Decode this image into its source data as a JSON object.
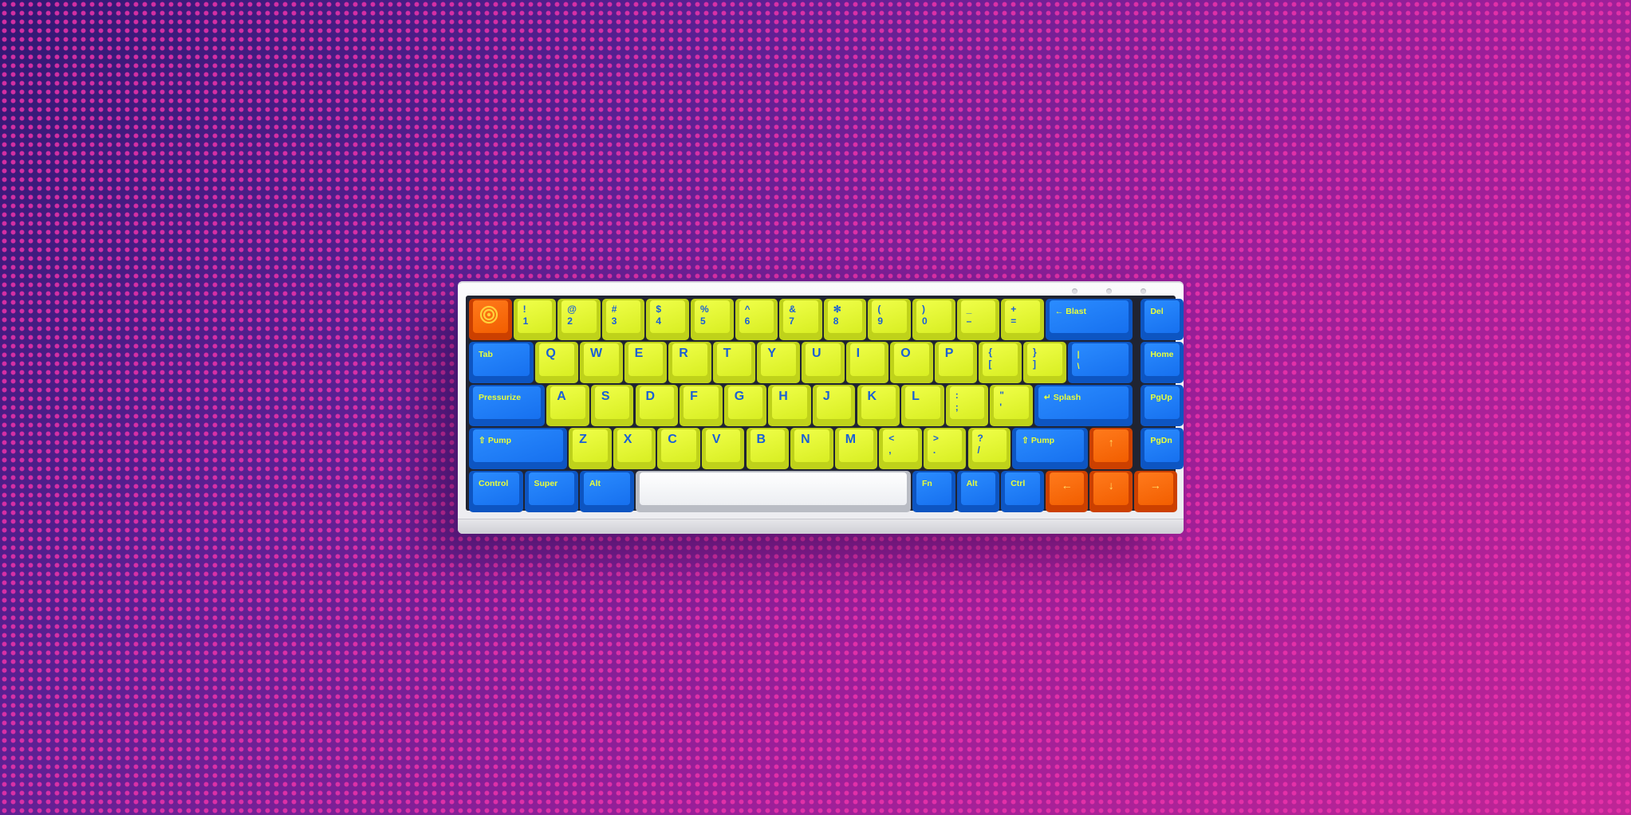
{
  "colors": {
    "alpha_keys": "#e6f72a",
    "modifier_keys": "#1a73f0",
    "accent_keys": "#f56300",
    "space_bar": "#f4f5f7",
    "case": "#f2f2f5",
    "background_start": "#321873",
    "background_end": "#bf2596"
  },
  "keyboard": {
    "rows": [
      [
        {
          "id": "esc",
          "color": "o",
          "icon": "target-icon",
          "w": 1
        },
        {
          "id": "1",
          "label": "!\n1",
          "color": "y",
          "w": 1
        },
        {
          "id": "2",
          "label": "@\n2",
          "color": "y",
          "w": 1
        },
        {
          "id": "3",
          "label": "#\n3",
          "color": "y",
          "w": 1
        },
        {
          "id": "4",
          "label": "$\n4",
          "color": "y",
          "w": 1
        },
        {
          "id": "5",
          "label": "%\n5",
          "color": "y",
          "w": 1
        },
        {
          "id": "6",
          "label": "^\n6",
          "color": "y",
          "w": 1
        },
        {
          "id": "7",
          "label": "&\n7",
          "color": "y",
          "w": 1
        },
        {
          "id": "8",
          "label": "✻\n8",
          "color": "y",
          "w": 1
        },
        {
          "id": "9",
          "label": "(\n9",
          "color": "y",
          "w": 1
        },
        {
          "id": "0",
          "label": ")\n0",
          "color": "y",
          "w": 1
        },
        {
          "id": "minus",
          "label": "_\n–",
          "color": "y",
          "w": 1
        },
        {
          "id": "equal",
          "label": "+\n=",
          "color": "y",
          "w": 1
        },
        {
          "id": "backspace",
          "label": "Blast",
          "icon": "arrow-left-icon",
          "color": "b",
          "w": 2
        },
        {
          "id": "gap",
          "gap": 0.15
        },
        {
          "id": "del",
          "label": "Del",
          "color": "b",
          "w": 1
        }
      ],
      [
        {
          "id": "tab",
          "label": "Tab",
          "color": "b",
          "w": 1.5
        },
        {
          "id": "q",
          "label": "Q",
          "color": "y",
          "w": 1,
          "big": true
        },
        {
          "id": "w",
          "label": "W",
          "color": "y",
          "w": 1,
          "big": true
        },
        {
          "id": "e",
          "label": "E",
          "color": "y",
          "w": 1,
          "big": true
        },
        {
          "id": "r",
          "label": "R",
          "color": "y",
          "w": 1,
          "big": true
        },
        {
          "id": "t",
          "label": "T",
          "color": "y",
          "w": 1,
          "big": true
        },
        {
          "id": "y",
          "label": "Y",
          "color": "y",
          "w": 1,
          "big": true
        },
        {
          "id": "u",
          "label": "U",
          "color": "y",
          "w": 1,
          "big": true
        },
        {
          "id": "i",
          "label": "I",
          "color": "y",
          "w": 1,
          "big": true
        },
        {
          "id": "o",
          "label": "O",
          "color": "y",
          "w": 1,
          "big": true
        },
        {
          "id": "p",
          "label": "P",
          "color": "y",
          "w": 1,
          "big": true
        },
        {
          "id": "lbracket",
          "label": "{\n[",
          "color": "y",
          "w": 1
        },
        {
          "id": "rbracket",
          "label": "}\n]",
          "color": "y",
          "w": 1
        },
        {
          "id": "backslash",
          "label": "|\n\\",
          "color": "b",
          "w": 1.5
        },
        {
          "id": "gap",
          "gap": 0.15
        },
        {
          "id": "home",
          "label": "Home",
          "color": "b",
          "w": 1
        }
      ],
      [
        {
          "id": "caps",
          "label": "Pressurize",
          "color": "b",
          "w": 1.75
        },
        {
          "id": "a",
          "label": "A",
          "color": "y",
          "w": 1,
          "big": true
        },
        {
          "id": "s",
          "label": "S",
          "color": "y",
          "w": 1,
          "big": true
        },
        {
          "id": "d",
          "label": "D",
          "color": "y",
          "w": 1,
          "big": true
        },
        {
          "id": "f",
          "label": "F",
          "color": "y",
          "w": 1,
          "big": true
        },
        {
          "id": "g",
          "label": "G",
          "color": "y",
          "w": 1,
          "big": true
        },
        {
          "id": "h",
          "label": "H",
          "color": "y",
          "w": 1,
          "big": true
        },
        {
          "id": "j",
          "label": "J",
          "color": "y",
          "w": 1,
          "big": true
        },
        {
          "id": "k",
          "label": "K",
          "color": "y",
          "w": 1,
          "big": true
        },
        {
          "id": "l",
          "label": "L",
          "color": "y",
          "w": 1,
          "big": true
        },
        {
          "id": "semicolon",
          "label": ":\n;",
          "color": "y",
          "w": 1
        },
        {
          "id": "quote",
          "label": "\"\n'",
          "color": "y",
          "w": 1
        },
        {
          "id": "enter",
          "label": "Splash",
          "icon": "return-icon",
          "color": "b",
          "w": 2.25
        },
        {
          "id": "gap",
          "gap": 0.15
        },
        {
          "id": "pgup",
          "label": "PgUp",
          "color": "b",
          "w": 1
        }
      ],
      [
        {
          "id": "lshift",
          "label": "Pump",
          "icon": "shift-icon",
          "color": "b",
          "w": 2.25
        },
        {
          "id": "z",
          "label": "Z",
          "color": "y",
          "w": 1,
          "big": true
        },
        {
          "id": "x",
          "label": "X",
          "color": "y",
          "w": 1,
          "big": true
        },
        {
          "id": "c",
          "label": "C",
          "color": "y",
          "w": 1,
          "big": true
        },
        {
          "id": "v",
          "label": "V",
          "color": "y",
          "w": 1,
          "big": true
        },
        {
          "id": "b",
          "label": "B",
          "color": "y",
          "w": 1,
          "big": true
        },
        {
          "id": "n",
          "label": "N",
          "color": "y",
          "w": 1,
          "big": true
        },
        {
          "id": "m",
          "label": "M",
          "color": "y",
          "w": 1,
          "big": true
        },
        {
          "id": "comma",
          "label": "<\n,",
          "color": "y",
          "w": 1
        },
        {
          "id": "period",
          "label": ">\n.",
          "color": "y",
          "w": 1
        },
        {
          "id": "slash",
          "label": "?\n/",
          "color": "y",
          "w": 1
        },
        {
          "id": "rshift",
          "label": "Pump",
          "icon": "shift-icon",
          "color": "b",
          "w": 1.75
        },
        {
          "id": "up",
          "label": "↑",
          "icon": "arrow-up-icon",
          "color": "o",
          "w": 1
        },
        {
          "id": "gap",
          "gap": 0.15
        },
        {
          "id": "pgdn",
          "label": "PgDn",
          "color": "b",
          "w": 1
        }
      ],
      [
        {
          "id": "lctrl",
          "label": "Control",
          "color": "b",
          "w": 1.25
        },
        {
          "id": "super",
          "label": "Super",
          "color": "b",
          "w": 1.25
        },
        {
          "id": "lalt",
          "label": "Alt",
          "color": "b",
          "w": 1.25
        },
        {
          "id": "space",
          "label": "",
          "color": "w",
          "w": 6.25
        },
        {
          "id": "fn",
          "label": "Fn",
          "color": "b",
          "w": 1
        },
        {
          "id": "ralt",
          "label": "Alt",
          "color": "b",
          "w": 1
        },
        {
          "id": "rctrl",
          "label": "Ctrl",
          "color": "b",
          "w": 1
        },
        {
          "id": "left",
          "label": "←",
          "icon": "arrow-left-icon",
          "color": "o",
          "w": 1
        },
        {
          "id": "down",
          "label": "↓",
          "icon": "arrow-down-icon",
          "color": "o",
          "w": 1
        },
        {
          "id": "right",
          "label": "→",
          "icon": "arrow-right-icon",
          "color": "o",
          "w": 1
        }
      ]
    ]
  }
}
